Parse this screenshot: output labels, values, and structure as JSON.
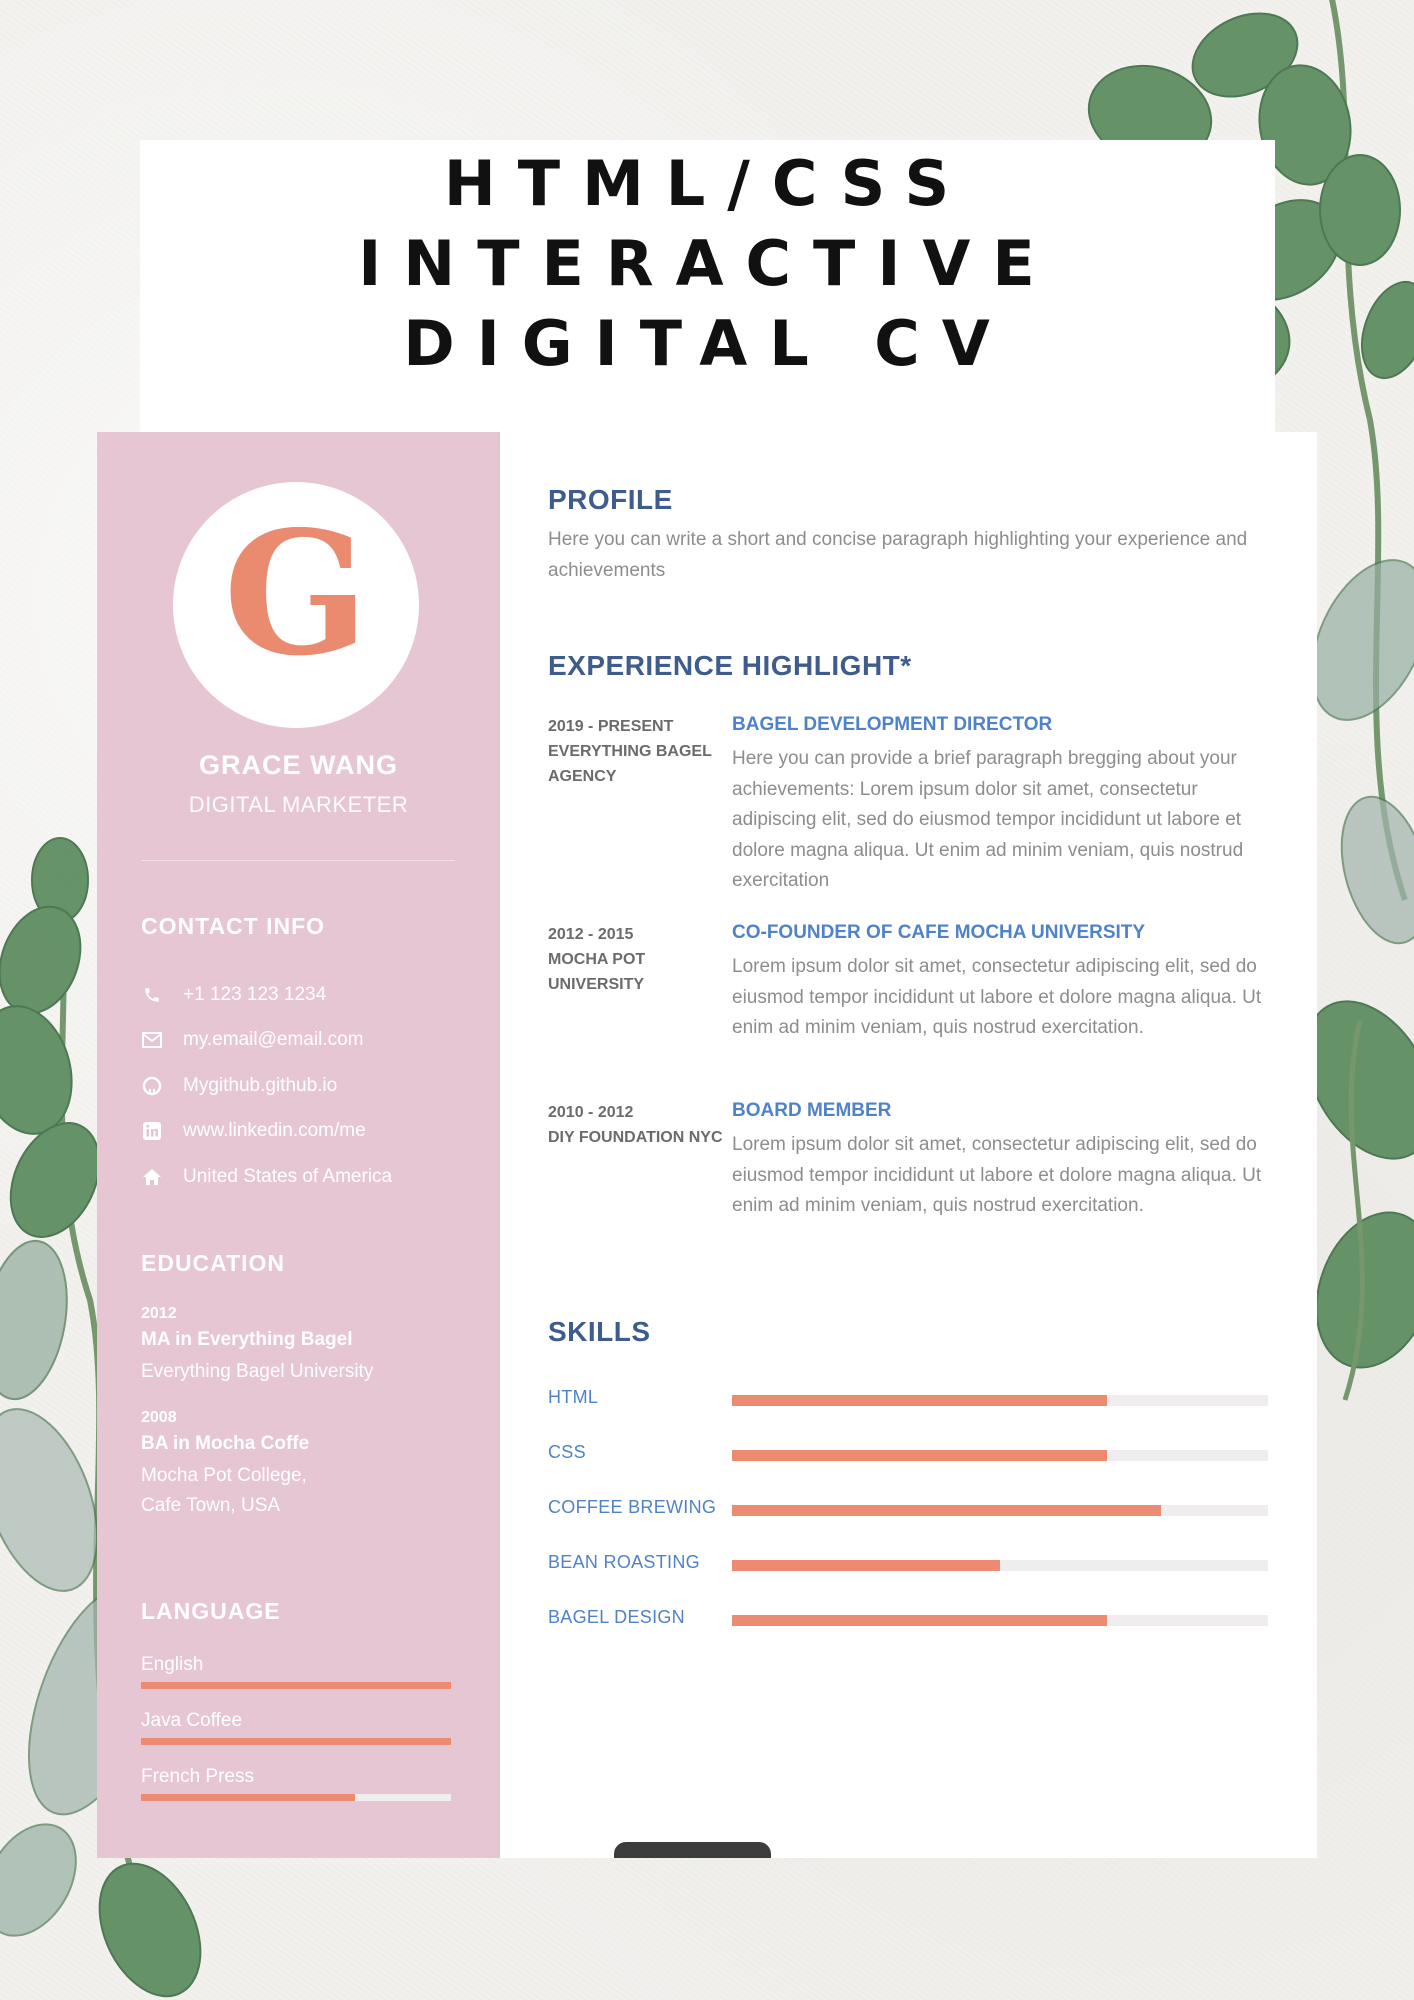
{
  "banner": {
    "title_lines": [
      "HTML/CSS",
      "INTERACTIVE",
      "DIGITAL CV"
    ]
  },
  "sidebar": {
    "monogram": "G",
    "name": "GRACE WANG",
    "role": "DIGITAL MARKETER",
    "contact_heading": "CONTACT INFO",
    "contacts": [
      {
        "icon": "phone-icon",
        "text": "+1 123 123 1234"
      },
      {
        "icon": "envelope-icon",
        "text": "my.email@email.com"
      },
      {
        "icon": "github-icon",
        "text": "Mygithub.github.io"
      },
      {
        "icon": "linkedin-icon",
        "text": "www.linkedin.com/me"
      },
      {
        "icon": "home-icon",
        "text": "United States of America"
      }
    ],
    "education_heading": "EDUCATION",
    "education": [
      {
        "year": "2012",
        "degree": "MA in Everything Bagel",
        "school": "Everything Bagel University"
      },
      {
        "year": "2008",
        "degree": "BA in Mocha Coffe",
        "school": "Mocha Pot College,\nCafe Town, USA"
      }
    ],
    "language_heading": "LANGUAGE",
    "languages": [
      {
        "label": "English",
        "level": 1.0
      },
      {
        "label": "Java Coffee",
        "level": 1.0
      },
      {
        "label": "French Press",
        "level": 0.69
      }
    ]
  },
  "main": {
    "profile_heading": "PROFILE",
    "profile_text": "Here you can write a short and concise paragraph highlighting your experience and achievements",
    "experience_heading": "EXPERIENCE HIGHLIGHT*",
    "experience": [
      {
        "date": "2019 - PRESENT\nEVERYTHING BAGEL\nAGENCY",
        "title": "BAGEL DEVELOPMENT DIRECTOR",
        "description": "Here you can provide a brief paragraph bregging about your achievements: Lorem ipsum dolor sit amet, consectetur adipiscing elit, sed do eiusmod tempor incididunt ut labore et dolore magna aliqua. Ut enim ad minim veniam, quis nostrud exercitation"
      },
      {
        "date": "2012 - 2015\nMOCHA POT\nUNIVERSITY",
        "title": "CO-FOUNDER OF CAFE MOCHA UNIVERSITY",
        "description": "Lorem ipsum dolor sit amet, consectetur adipiscing elit, sed do eiusmod tempor incididunt ut labore et dolore magna aliqua. Ut enim ad minim veniam, quis nostrud exercitation."
      },
      {
        "date": "2010 - 2012\nDIY FOUNDATION NYC",
        "title": "BOARD MEMBER",
        "description": "Lorem ipsum dolor sit amet, consectetur adipiscing elit, sed do eiusmod tempor incididunt ut labore et dolore magna aliqua. Ut enim ad minim veniam, quis nostrud exercitation."
      }
    ],
    "skills_heading": "SKILLS",
    "skills": [
      {
        "label": "HTML",
        "level": 0.7
      },
      {
        "label": "CSS",
        "level": 0.7
      },
      {
        "label": "COFFEE BREWING",
        "level": 0.8
      },
      {
        "label": "BEAN ROASTING",
        "level": 0.5
      },
      {
        "label": "BAGEL DESIGN",
        "level": 0.7
      }
    ]
  },
  "colors": {
    "sidebar_bg": "#e7c6d4",
    "accent": "#ec8a72",
    "heading": "#3f5d8c",
    "link_blue": "#4f82c8",
    "leaf_green": "#4f7f52"
  }
}
